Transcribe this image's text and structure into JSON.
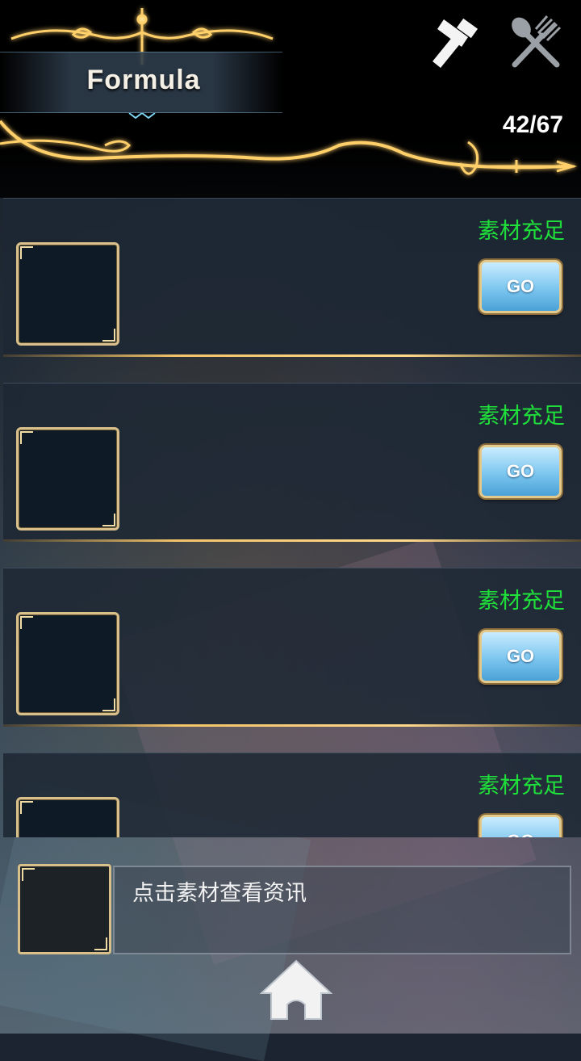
{
  "header": {
    "title": "Formula",
    "counter": "42/67",
    "icons": [
      "hammer-icon",
      "fork-spoon-icon"
    ]
  },
  "recipes": [
    {
      "status": "素材充足",
      "button": "GO"
    },
    {
      "status": "素材充足",
      "button": "GO"
    },
    {
      "status": "素材充足",
      "button": "GO"
    },
    {
      "status": "素材充足",
      "button": "GO"
    }
  ],
  "info": {
    "hint": "点击素材查看资讯"
  },
  "colors": {
    "status_green": "#1fe03a",
    "gold": "#f2c36a",
    "go_blue": "#7cc6ef"
  },
  "footer": {
    "home_icon": "home-icon"
  }
}
